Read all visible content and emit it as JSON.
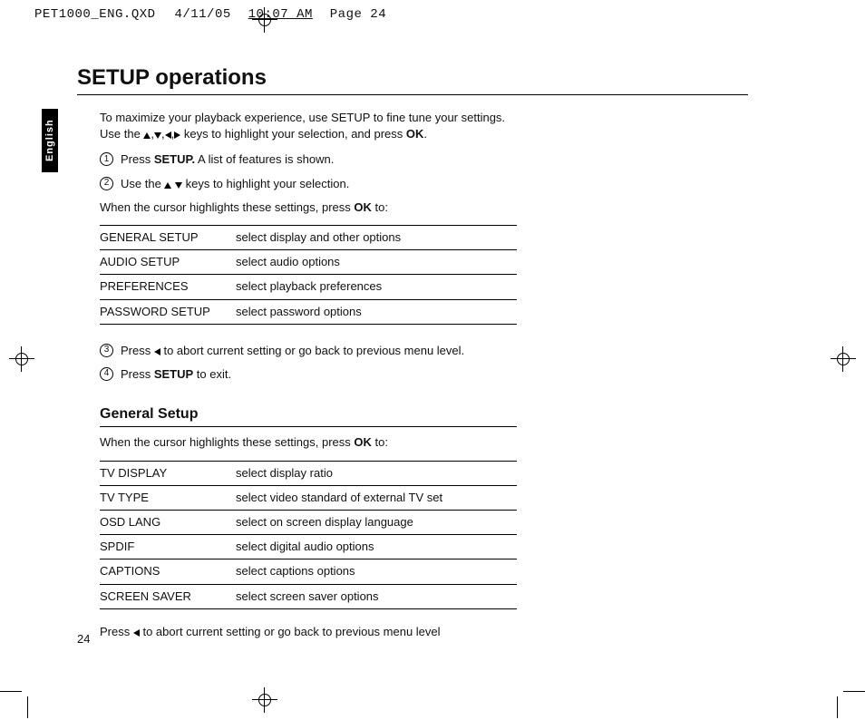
{
  "slug": {
    "file": "PET1000_ENG.QXD",
    "date": "4/11/05",
    "time": "10:07 AM",
    "page_label": "Page 24"
  },
  "lang_tab": "English",
  "title": "SETUP operations",
  "intro_a": "To maximize your playback experience, use SETUP to fine tune your settings.",
  "intro_b_pre": "Use the ",
  "intro_b_post": " keys to highlight your selection, and press ",
  "ok": "OK",
  "period": ".",
  "steps": {
    "s1": {
      "num": "1",
      "pre": "Press ",
      "bold": "SETUP.",
      "post": " A list of features is shown."
    },
    "s2": {
      "num": "2",
      "pre": "Use the ",
      "post": " keys to highlight your selection."
    }
  },
  "cursor_line_pre": "When the cursor highlights these settings, press ",
  "cursor_line_post": " to:",
  "table_main": [
    {
      "label": "GENERAL SETUP",
      "desc": "select display and other options"
    },
    {
      "label": "AUDIO SETUP",
      "desc": "select audio options"
    },
    {
      "label": "PREFERENCES",
      "desc": "select playback preferences"
    },
    {
      "label": "PASSWORD SETUP",
      "desc": "select password options"
    }
  ],
  "steps2": {
    "s3": {
      "num": "3",
      "pre": "Press ",
      "post": " to abort current setting or go back to previous menu level."
    },
    "s4": {
      "num": "4",
      "pre": "Press ",
      "bold": "SETUP",
      "post": " to exit."
    }
  },
  "general_setup": {
    "title": "General Setup",
    "cursor_pre": "When the cursor highlights these settings, press ",
    "cursor_post": " to:",
    "rows": [
      {
        "label": "TV DISPLAY",
        "desc": "select display ratio"
      },
      {
        "label": "TV TYPE",
        "desc": "select video standard of external TV set"
      },
      {
        "label": "OSD LANG",
        "desc": "select on screen display language"
      },
      {
        "label": "SPDIF",
        "desc": "select digital audio options"
      },
      {
        "label": "CAPTIONS",
        "desc": "select captions options"
      },
      {
        "label": "SCREEN SAVER",
        "desc": "select screen saver options"
      }
    ],
    "footer_pre": "Press ",
    "footer_post": " to abort current setting or go back to previous menu level"
  },
  "page_number": "24"
}
